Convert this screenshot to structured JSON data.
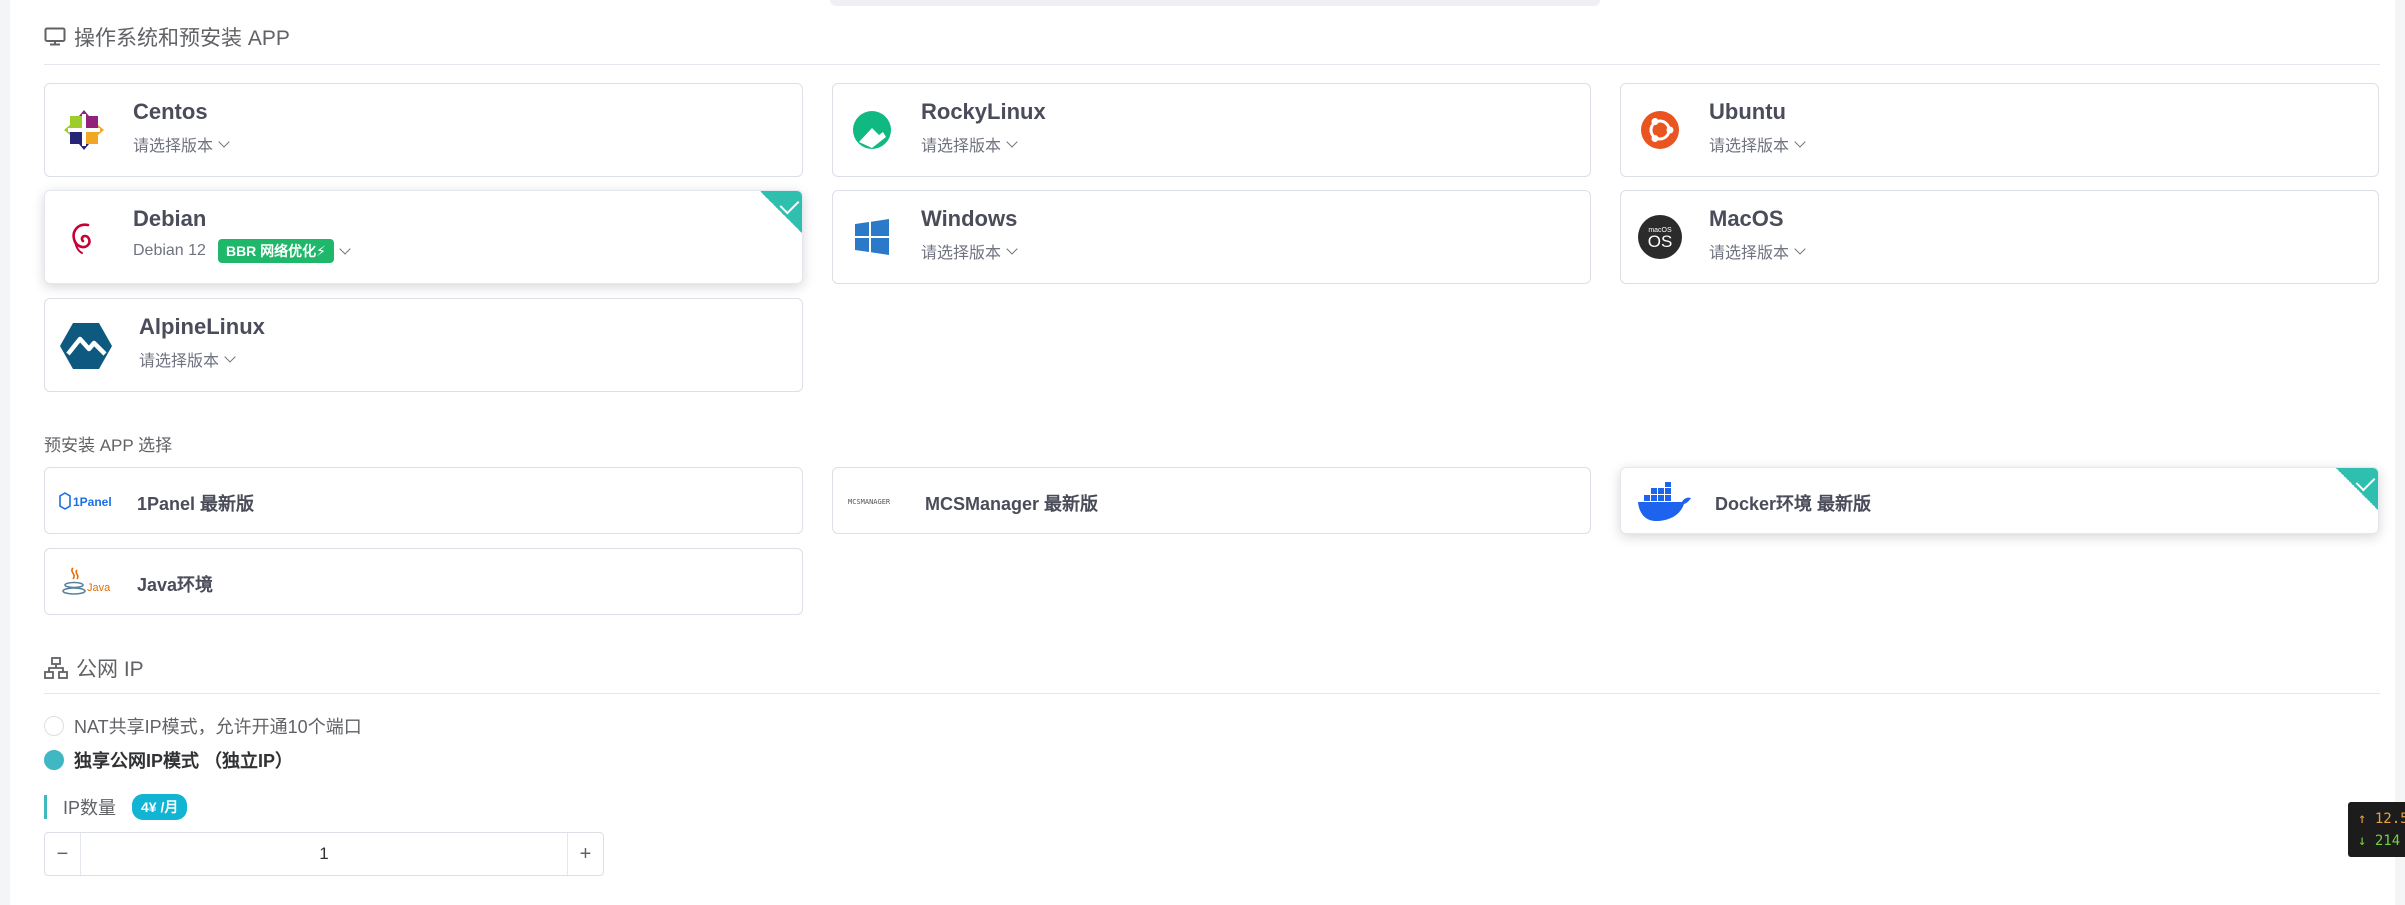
{
  "os_section": {
    "title": "操作系统和预安装 APP",
    "items": [
      {
        "name": "Centos",
        "version": "请选择版本"
      },
      {
        "name": "RockyLinux",
        "version": "请选择版本"
      },
      {
        "name": "Ubuntu",
        "version": "请选择版本"
      },
      {
        "name": "Debian",
        "version": "Debian 12",
        "badge": "BBR 网络优化⚡"
      },
      {
        "name": "Windows",
        "version": "请选择版本"
      },
      {
        "name": "MacOS",
        "version": "请选择版本"
      },
      {
        "name": "AlpineLinux",
        "version": "请选择版本"
      }
    ],
    "selected": "Debian",
    "macos_logo_top": "macOS",
    "macos_logo_main": "OS"
  },
  "app_section": {
    "title": "预安装 APP 选择",
    "items": [
      {
        "name": "1Panel 最新版",
        "logo_text": "1Panel"
      },
      {
        "name": "MCSManager 最新版",
        "logo_text": "MCSMANAGER"
      },
      {
        "name": "Docker环境 最新版"
      },
      {
        "name": "Java环境",
        "logo_text": "Java"
      }
    ],
    "selected": "Docker环境 最新版"
  },
  "ip_section": {
    "title": "公网 IP",
    "options": [
      {
        "label": "NAT共享IP模式，允许开通10个端口",
        "checked": false
      },
      {
        "label": "独享公网IP模式 （独立IP）",
        "checked": true
      }
    ],
    "count_label": "IP数量",
    "price_badge": "4¥ /月",
    "count_value": "1",
    "minus": "−",
    "plus": "+"
  },
  "speed_widget": {
    "up": "↑ 12.5",
    "down": "↓ 214"
  },
  "colors": {
    "accent": "#3fb8c4",
    "selected_corner": "#2fbfae",
    "bbr_badge": "#1fb76a",
    "price_badge": "#12b4d4"
  }
}
